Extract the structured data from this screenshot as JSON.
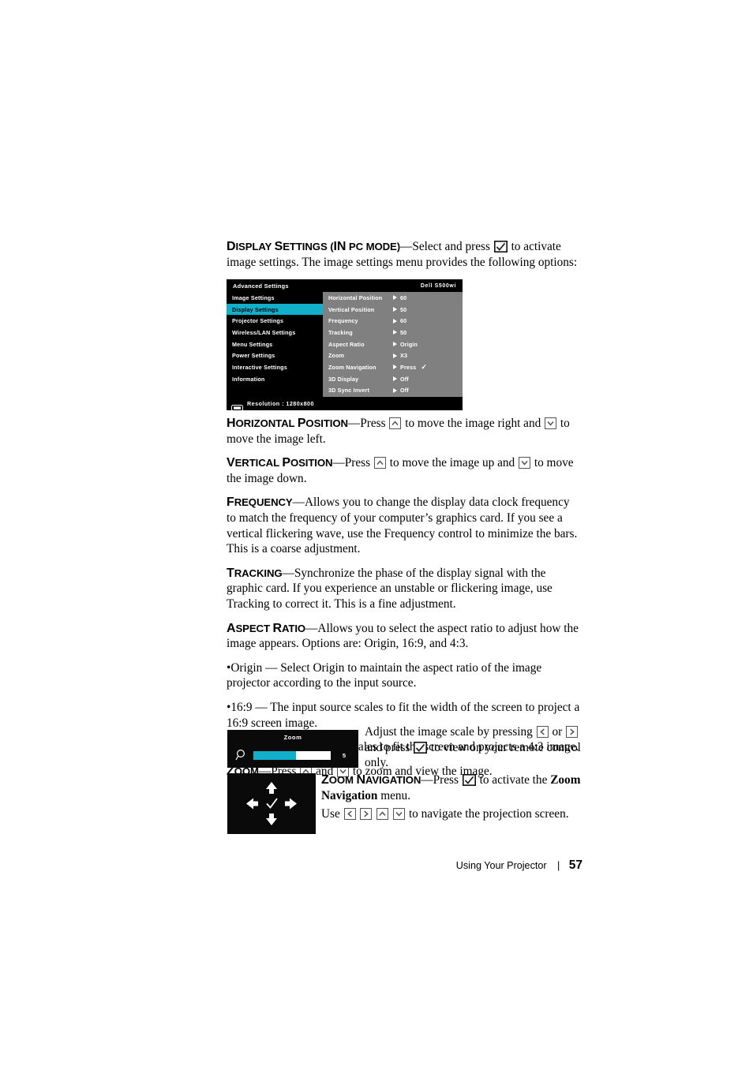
{
  "doc": {
    "section_heading_term": "Display Settings (in PC Mode)",
    "section_heading_dash": "—",
    "intro_part1": "Select and press",
    "intro_part2": "to activate image settings. The image settings menu provides the following options:"
  },
  "osd": {
    "title": "Advanced Settings",
    "model": "Dell S500wi",
    "accent_color": "#12AFCB",
    "background_color": "#000000",
    "panel_color": "#808080",
    "sidebar": [
      {
        "label": "Image Settings",
        "selected": false
      },
      {
        "label": "Display Settings",
        "selected": true
      },
      {
        "label": "Projector Settings",
        "selected": false
      },
      {
        "label": "Wireless/LAN Settings",
        "selected": false
      },
      {
        "label": "Menu Settings",
        "selected": false
      },
      {
        "label": "Power Settings",
        "selected": false
      },
      {
        "label": "Interactive Settings",
        "selected": false
      },
      {
        "label": "Information",
        "selected": false
      }
    ],
    "rows": [
      {
        "label": "Horizontal Position",
        "value": "60",
        "check": false
      },
      {
        "label": "Vertical Position",
        "value": "50",
        "check": false
      },
      {
        "label": "Frequency",
        "value": "60",
        "check": false
      },
      {
        "label": "Tracking",
        "value": "50",
        "check": false
      },
      {
        "label": "Aspect Ratio",
        "value": "Origin",
        "check": false
      },
      {
        "label": "Zoom",
        "value": "X3",
        "check": false
      },
      {
        "label": "Zoom Navigation",
        "value": "Press",
        "check": true
      },
      {
        "label": "3D Display",
        "value": "Off",
        "check": false
      },
      {
        "label": "3D Sync Invert",
        "value": "Off",
        "check": false
      }
    ],
    "footer_label": "Resolution : 1280x800",
    "footer_icon": "resolution-icon"
  },
  "sections": {
    "horizontal_position": {
      "term": "Horizontal Position",
      "t1": "Press",
      "t2": "to move the image right and",
      "t3": "to move the image left."
    },
    "vertical_position": {
      "term": "Vertical Position",
      "t1": "Press",
      "t2": "to move the image up and",
      "t3": "to move the image down."
    },
    "frequency": {
      "term": "Frequency",
      "text": "Allows you to change the display data clock frequency to match the frequency of your computer’s graphics card. If you see a vertical flickering wave, use the Frequency control to minimize the bars. This is a coarse adjustment."
    },
    "tracking": {
      "term": "Tracking",
      "text": "Synchronize the phase of the display signal with the graphic card. If you experience an unstable or flickering image, use Tracking to correct it. This is a fine adjustment."
    },
    "aspect_ratio": {
      "term": "Aspect Ratio",
      "text": "Allows you to select the aspect ratio to adjust how the image appears. Options are: Origin, 16:9, and 4:3.",
      "bullets": [
        "•Origin — Select Origin to maintain the aspect ratio of the image projector according to the input source.",
        "•16:9 — The input source scales to fit the width of the screen to project a 16:9 screen image.",
        "•4:3 — The input source scales to fit the screen and projects a 4:3 image."
      ]
    },
    "zoom": {
      "term": "Zoom",
      "t1": "Press",
      "t2": "and",
      "t3": "to zoom and view the image.",
      "side_t1": "Adjust the image scale by pressing",
      "side_t2": "or",
      "side_t3": "and press",
      "side_t4": "to view on your remote control only."
    },
    "zoom_navigation": {
      "term": "Zoom Navigation",
      "t1": "Press",
      "t2": "to activate the",
      "t2_bold": "Zoom Navigation",
      "t3": "menu.",
      "t4": "Use",
      "t5": "to navigate the projection screen."
    }
  },
  "zoom_widget": {
    "title": "Zoom",
    "value": "5",
    "fill_percent": 55,
    "bar_fill_color": "#12AFCB",
    "bar_track_color": "#FFFFFF",
    "icon": "magnifier-icon"
  },
  "nav_pad": {
    "up": "up-arrow-icon",
    "down": "down-arrow-icon",
    "left": "left-arrow-icon",
    "right": "right-arrow-icon",
    "center": "check-icon"
  },
  "footer": {
    "text": "Using Your Projector",
    "separator": "|",
    "page": "57"
  },
  "icons": {
    "up_key": "up-key-icon",
    "down_key": "down-key-icon",
    "left_key": "left-key-icon",
    "right_key": "right-key-icon",
    "enter_key": "enter-key-icon"
  }
}
